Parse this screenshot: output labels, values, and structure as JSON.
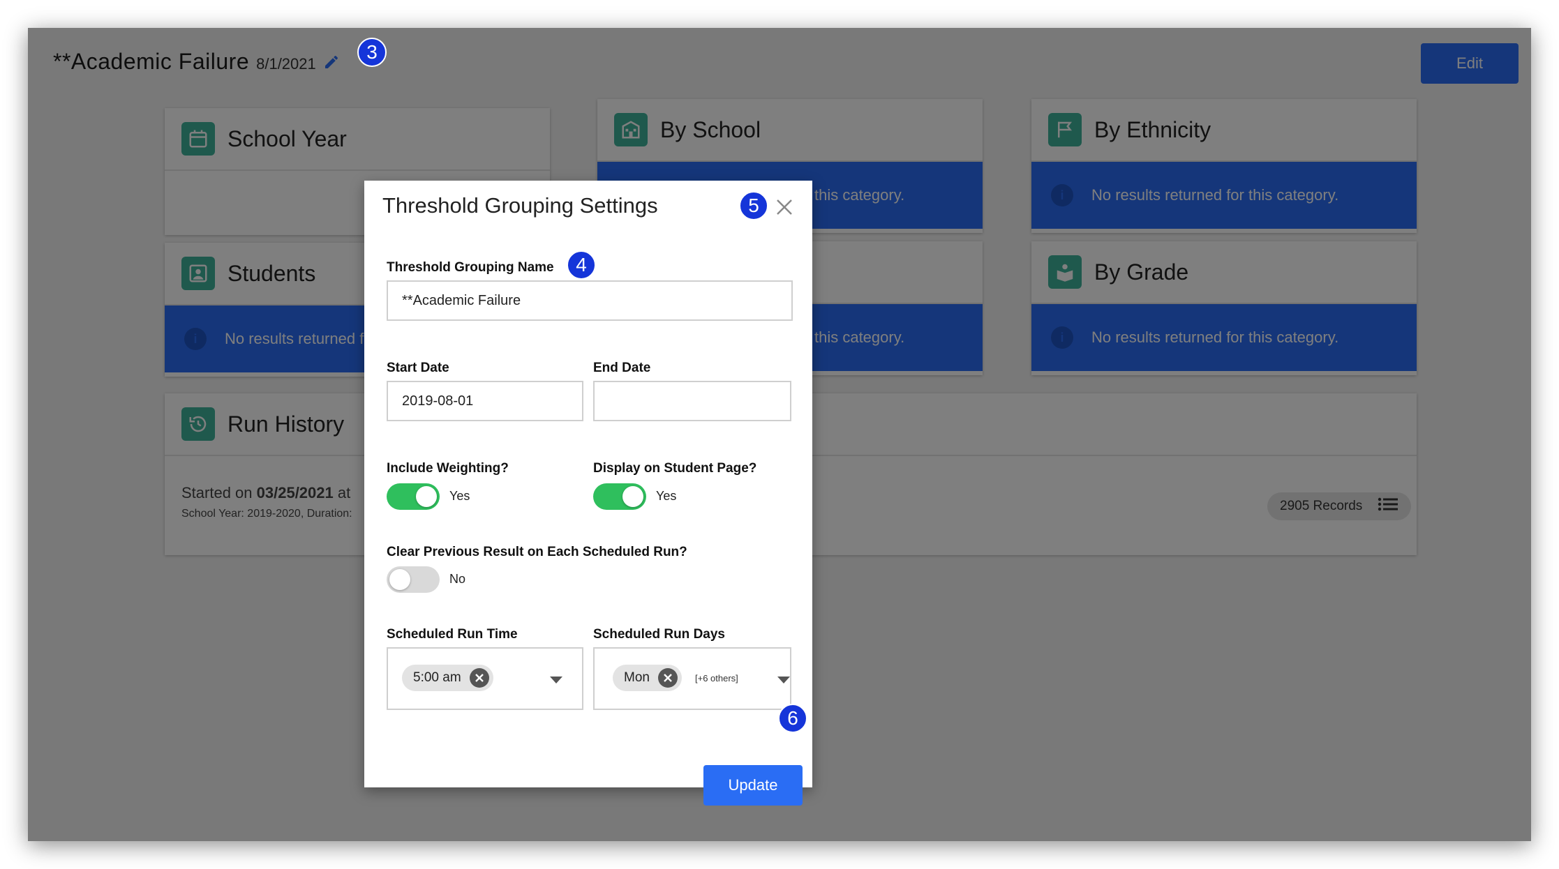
{
  "header": {
    "title": "**Academic Failure",
    "date": "8/1/2021",
    "edit_label": "Edit"
  },
  "cards": {
    "school_year": {
      "title": "School Year"
    },
    "by_school": {
      "title": "By School",
      "alert": "No results returned for this category."
    },
    "by_ethnicity": {
      "title": "By Ethnicity",
      "alert": "No results returned for this category."
    },
    "students": {
      "title": "Students",
      "alert": "No results returned for this category."
    },
    "middle_second": {
      "alert": "No results returned for this category."
    },
    "by_grade": {
      "title": "By Grade",
      "alert": "No results returned for this category."
    },
    "run_history": {
      "title": "Run History",
      "started_prefix": "Started on",
      "started_date": "03/25/2021",
      "started_suffix": "at",
      "detail": "School Year: 2019-2020, Duration:",
      "records": "2905 Records"
    }
  },
  "modal": {
    "title": "Threshold Grouping Settings",
    "name_label": "Threshold Grouping Name",
    "name_value": "**Academic Failure",
    "start_label": "Start Date",
    "start_value": "2019-08-01",
    "end_label": "End Date",
    "end_value": "",
    "weighting_label": "Include Weighting?",
    "weighting_value": "Yes",
    "display_label": "Display on Student Page?",
    "display_value": "Yes",
    "clear_label": "Clear Previous Result on Each Scheduled Run?",
    "clear_value": "No",
    "run_time_label": "Scheduled Run Time",
    "run_time_value": "5:00 am",
    "run_days_label": "Scheduled Run Days",
    "run_days_value": "Mon",
    "run_days_others": "[+6 others]",
    "update_label": "Update"
  },
  "badges": {
    "b3": "3",
    "b4": "4",
    "b5": "5",
    "b6": "6"
  },
  "icons": {
    "school_year": "calendar-icon",
    "by_school": "school-building-icon",
    "by_ethnicity": "flag-icon",
    "students": "student-icon",
    "by_grade": "grade-icon",
    "run_history": "history-icon",
    "edit_title": "pencil-icon",
    "close": "close-icon",
    "records": "list-icon"
  },
  "colors": {
    "primary": "#2a6df4",
    "teal": "#3fb39a",
    "toggle_on": "#2fbf5d",
    "badge": "#1535d9"
  }
}
